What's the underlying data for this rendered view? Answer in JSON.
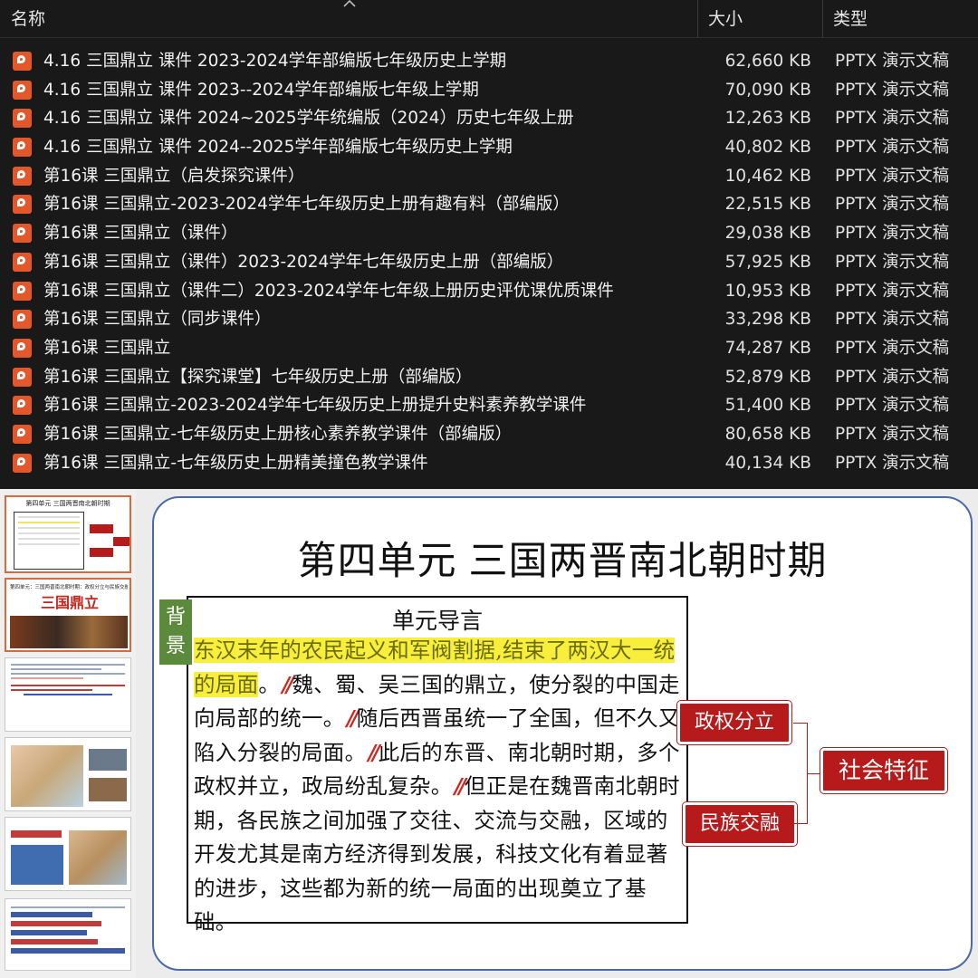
{
  "explorer": {
    "columns": {
      "name": "名称",
      "size": "大小",
      "type": "类型"
    },
    "files": [
      {
        "name": "4.16 三国鼎立 课件 2023-2024学年部编版七年级历史上学期",
        "size": "62,660 KB",
        "type": "PPTX 演示文稿"
      },
      {
        "name": "4.16 三国鼎立 课件 2023--2024学年部编版七年级上学期",
        "size": "70,090 KB",
        "type": "PPTX 演示文稿"
      },
      {
        "name": "4.16 三国鼎立 课件 2024~2025学年统编版（2024）历史七年级上册",
        "size": "12,263 KB",
        "type": "PPTX 演示文稿"
      },
      {
        "name": "4.16 三国鼎立 课件 2024--2025学年部编版七年级历史上学期",
        "size": "40,802 KB",
        "type": "PPTX 演示文稿"
      },
      {
        "name": "第16课  三国鼎立（启发探究课件）",
        "size": "10,462 KB",
        "type": "PPTX 演示文稿"
      },
      {
        "name": "第16课  三国鼎立-2023-2024学年七年级历史上册有趣有料（部编版）",
        "size": "22,515 KB",
        "type": "PPTX 演示文稿"
      },
      {
        "name": "第16课 三国鼎立（课件）",
        "size": "29,038 KB",
        "type": "PPTX 演示文稿"
      },
      {
        "name": "第16课 三国鼎立（课件）2023-2024学年七年级历史上册（部编版）",
        "size": "57,925 KB",
        "type": "PPTX 演示文稿"
      },
      {
        "name": "第16课 三国鼎立（课件二）2023-2024学年七年级上册历史评优课优质课件",
        "size": "10,953 KB",
        "type": "PPTX 演示文稿"
      },
      {
        "name": "第16课 三国鼎立（同步课件）",
        "size": "33,298 KB",
        "type": "PPTX 演示文稿"
      },
      {
        "name": "第16课 三国鼎立",
        "size": "74,287 KB",
        "type": "PPTX 演示文稿"
      },
      {
        "name": "第16课 三国鼎立【探究课堂】七年级历史上册（部编版）",
        "size": "52,879 KB",
        "type": "PPTX 演示文稿"
      },
      {
        "name": "第16课 三国鼎立-2023-2024学年七年级历史上册提升史料素养教学课件",
        "size": "51,400 KB",
        "type": "PPTX 演示文稿"
      },
      {
        "name": "第16课 三国鼎立-七年级历史上册核心素养教学课件（部编版）",
        "size": "80,658 KB",
        "type": "PPTX 演示文稿"
      },
      {
        "name": "第16课 三国鼎立-七年级历史上册精美撞色教学课件",
        "size": "40,134 KB",
        "type": "PPTX 演示文稿"
      }
    ],
    "file_icon": "powerpoint-file-icon",
    "sort_icon": "chevron-up-icon"
  },
  "thumbnails": {
    "t1_title": "第四单元 三国两晋南北朝时期",
    "t2_title": "三国鼎立",
    "t2_header": "第四单元：三国两晋南北朝时期：政权分立与民族交融"
  },
  "slide": {
    "title": "第四单元  三国两晋南北朝时期",
    "badge": "背景",
    "box_title": "单元导言",
    "text_highlight": "东汉末年的农民起义和军阀割据,结束了两汉大一统的局面",
    "text_p1": "魏、蜀、吴三国的鼎立，使分裂的中国走向局部的统一。",
    "text_p2": "随后西晋虽统一了全国，但不久又陷入分裂的局面。",
    "text_p3": "此后的东晋、南北朝时期，多个政权并立，政局纷乱复杂。",
    "text_p4": "但正是在魏晋南北朝时期，各民族之间加强了交往、交流与交融，区域的开发尤其是南方经济得到发展，科技文化有着显著的进步，这些都为新的统一局面的出现奠立了基础。",
    "slash": "//",
    "box_political": "政权分立",
    "box_ethnic": "民族交融",
    "box_social": "社会特征"
  },
  "colors": {
    "accent_red": "#b61a1a",
    "highlight_yellow": "#f7ef3b",
    "badge_green": "#5c8a3c",
    "slide_border": "#4c6aa6",
    "ppt_icon": "#e3572a"
  }
}
